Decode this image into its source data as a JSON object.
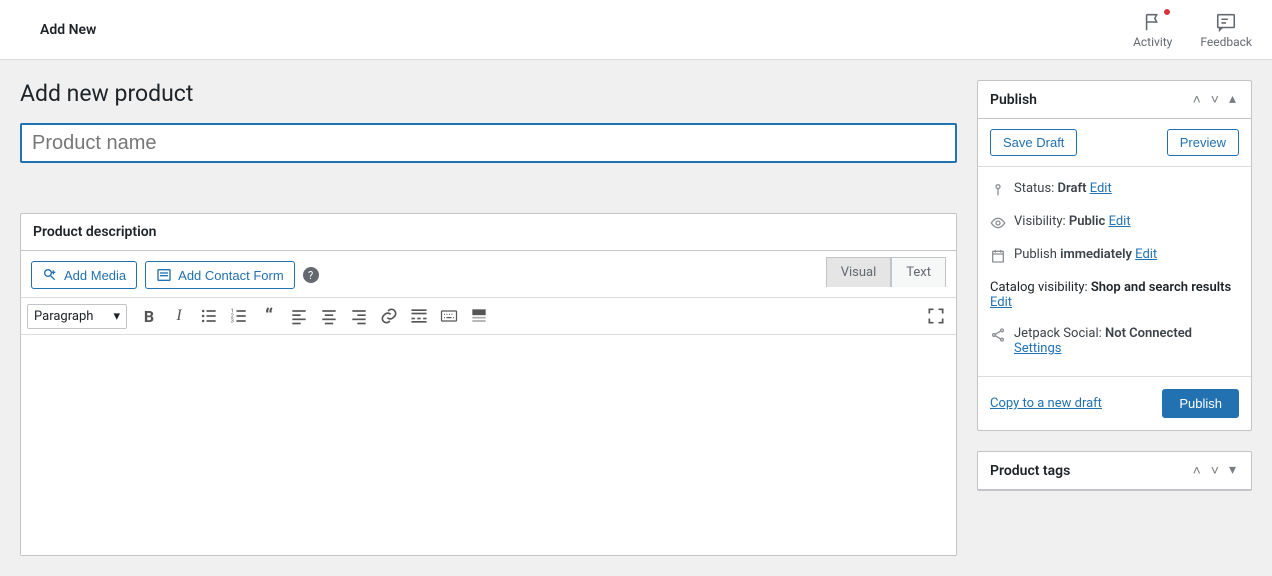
{
  "topbar": {
    "title": "Add New",
    "activity": "Activity",
    "feedback": "Feedback"
  },
  "page": {
    "heading": "Add new product",
    "title_placeholder": "Product name"
  },
  "editor": {
    "section_title": "Product description",
    "add_media": "Add Media",
    "add_contact": "Add Contact Form",
    "tab_visual": "Visual",
    "tab_text": "Text",
    "format_select": "Paragraph"
  },
  "publish": {
    "box_title": "Publish",
    "save_draft": "Save Draft",
    "preview": "Preview",
    "status_label": "Status: ",
    "status_value": "Draft",
    "visibility_label": "Visibility: ",
    "visibility_value": "Public",
    "publish_label": "Publish ",
    "publish_value": "immediately",
    "catalog_label": "Catalog visibility: ",
    "catalog_value": "Shop and search results",
    "jetpack_label": "Jetpack Social: ",
    "jetpack_value": "Not Connected",
    "edit": "Edit",
    "settings": "Settings",
    "copy": "Copy to a new draft",
    "publish_btn": "Publish"
  },
  "tags": {
    "box_title": "Product tags"
  }
}
